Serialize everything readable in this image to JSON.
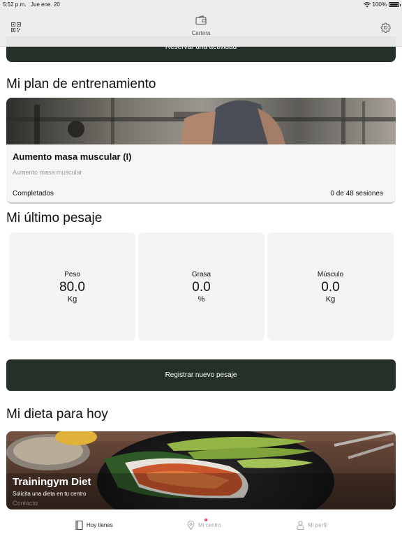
{
  "status_bar": {
    "time": "5:52 p.m.",
    "date": "Jue ene. 20",
    "battery": "100%",
    "icons": [
      "wifi-icon",
      "battery-icon"
    ]
  },
  "nav": {
    "wallet_label": "Cartera",
    "icons": [
      "qr-code-icon",
      "wallet-icon",
      "gear-icon"
    ]
  },
  "reserve": {
    "label": "Reservar una actividad"
  },
  "training": {
    "section_title": "Mi plan de entrenamiento",
    "plan_title": "Aumento masa muscular (I)",
    "plan_subtitle": "Aumento masa muscular",
    "completed_label": "Completados",
    "sessions_text": "0 de 48 sesiones"
  },
  "weigh": {
    "section_title": "Mi último pesaje",
    "cards": [
      {
        "label": "Peso",
        "value": "80.0",
        "unit": "Kg"
      },
      {
        "label": "Grasa",
        "value": "0.0",
        "unit": "%"
      },
      {
        "label": "Músculo",
        "value": "0.0",
        "unit": "Kg"
      }
    ],
    "register_label": "Registrar nuevo pesaje"
  },
  "diet": {
    "section_title": "Mi dieta para hoy",
    "title": "Trainingym Diet",
    "subtitle": "Solicita una dieta en tu centro",
    "contact": "Contacto"
  },
  "tabs": [
    {
      "label": "Hoy tienes",
      "icon": "book-icon",
      "active": true
    },
    {
      "label": "Mi centro",
      "icon": "location-pin-icon",
      "active": false,
      "badge_color": "#e2455c"
    },
    {
      "label": "Mi perfil",
      "icon": "person-icon",
      "active": false
    }
  ],
  "colors": {
    "primary_dark": "#253029",
    "card_bg": "#f4f4f4",
    "badge": "#e2455c"
  }
}
